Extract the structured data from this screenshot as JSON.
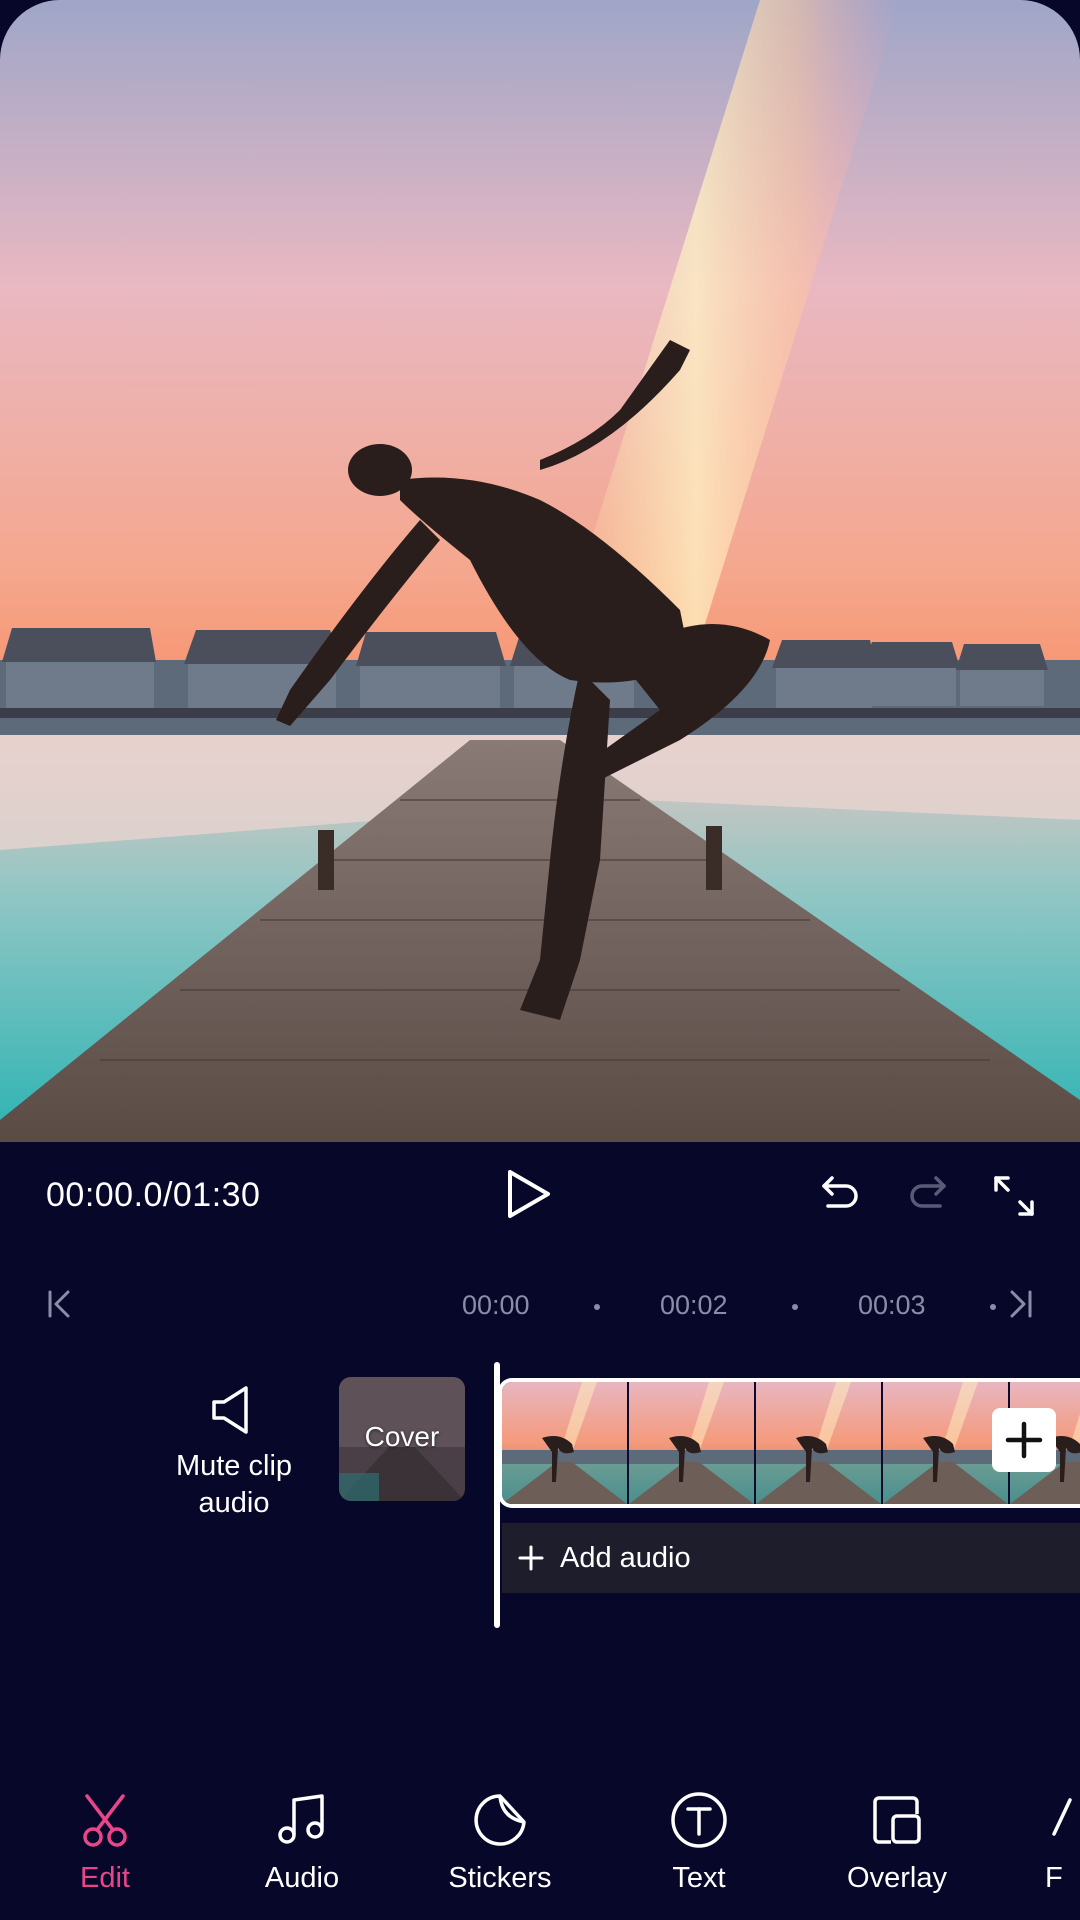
{
  "player": {
    "timecode": "00:00.0/01:30"
  },
  "ruler": {
    "ticks": [
      "00:00",
      "00:02",
      "00:03"
    ]
  },
  "timeline": {
    "mute_label": "Mute clip audio",
    "cover_label": "Cover",
    "add_audio_label": "Add audio",
    "frame_count": 5
  },
  "nav": {
    "items": [
      {
        "label": "Edit",
        "icon": "scissors-icon",
        "active": true
      },
      {
        "label": "Audio",
        "icon": "music-note-icon",
        "active": false
      },
      {
        "label": "Stickers",
        "icon": "sticker-icon",
        "active": false
      },
      {
        "label": "Text",
        "icon": "text-icon",
        "active": false
      },
      {
        "label": "Overlay",
        "icon": "overlay-icon",
        "active": false
      },
      {
        "label": "F",
        "icon": "filter-icon",
        "active": false
      }
    ]
  },
  "colors": {
    "background": "#07072a",
    "accent": "#e9468a",
    "muted_text": "#8c8ca8",
    "audio_track": "#1d1d2c"
  }
}
